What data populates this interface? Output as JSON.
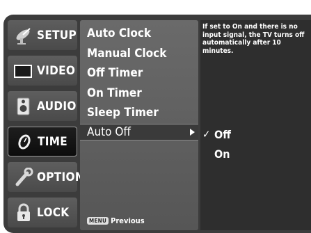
{
  "categories": [
    {
      "label": "SETUP",
      "icon": "satellite-dish-icon"
    },
    {
      "label": "VIDEO",
      "icon": "tv-screen-icon"
    },
    {
      "label": "AUDIO",
      "icon": "speaker-icon"
    },
    {
      "label": "TIME",
      "icon": "clock-icon",
      "active": true
    },
    {
      "label": "OPTION",
      "icon": "wrench-icon"
    },
    {
      "label": "LOCK",
      "icon": "padlock-icon"
    }
  ],
  "submenu": {
    "items": [
      "Auto Clock",
      "Manual Clock",
      "Off Timer",
      "On Timer",
      "Sleep Timer"
    ],
    "selected": "Auto Off"
  },
  "footer": {
    "key": "MENU",
    "label": "Previous"
  },
  "help_text": "If set to On and there is no input signal, the TV turns off automatically after 10 minutes.",
  "options": {
    "check_mark": "✓",
    "values": [
      "Off",
      "On"
    ],
    "selected": "Off"
  }
}
